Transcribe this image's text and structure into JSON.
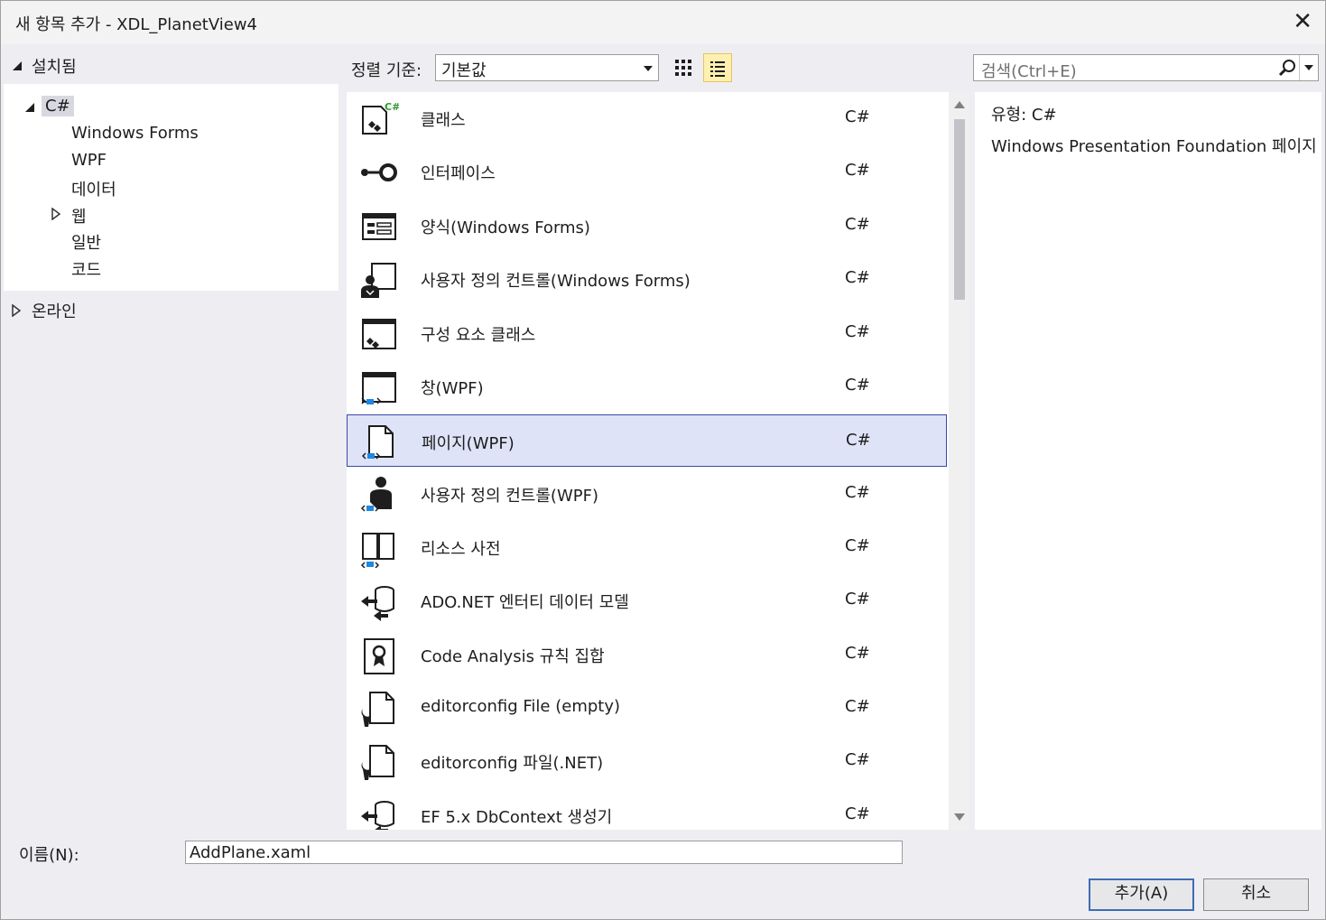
{
  "window": {
    "title": "새 항목 추가 - XDL_PlanetView4"
  },
  "tree": {
    "installed_label": "설치됨",
    "csharp_label": "C#",
    "children": [
      "Windows Forms",
      "WPF",
      "데이터",
      "웹",
      "일반",
      "코드"
    ],
    "online_label": "온라인"
  },
  "toolbar": {
    "sort_label": "정렬 기준:",
    "sort_value": "기본값",
    "search_placeholder": "검색(Ctrl+E)"
  },
  "templates": [
    {
      "name": "클래스",
      "lang": "C#",
      "icon": "class-icon"
    },
    {
      "name": "인터페이스",
      "lang": "C#",
      "icon": "interface-icon"
    },
    {
      "name": "양식(Windows Forms)",
      "lang": "C#",
      "icon": "form-icon"
    },
    {
      "name": "사용자 정의 컨트롤(Windows Forms)",
      "lang": "C#",
      "icon": "user-control-icon"
    },
    {
      "name": "구성 요소 클래스",
      "lang": "C#",
      "icon": "component-class-icon"
    },
    {
      "name": "창(WPF)",
      "lang": "C#",
      "icon": "window-icon"
    },
    {
      "name": "페이지(WPF)",
      "lang": "C#",
      "icon": "page-icon",
      "selected": true
    },
    {
      "name": "사용자 정의 컨트롤(WPF)",
      "lang": "C#",
      "icon": "wpf-user-control-icon"
    },
    {
      "name": "리소스 사전",
      "lang": "C#",
      "icon": "resource-dictionary-icon"
    },
    {
      "name": "ADO.NET 엔터티 데이터 모델",
      "lang": "C#",
      "icon": "entity-model-icon"
    },
    {
      "name": "Code Analysis 규칙 집합",
      "lang": "C#",
      "icon": "rule-set-icon"
    },
    {
      "name": "editorconfig File (empty)",
      "lang": "C#",
      "icon": "editorconfig-icon"
    },
    {
      "name": "editorconfig 파일(.NET)",
      "lang": "C#",
      "icon": "editorconfig-icon"
    },
    {
      "name": "EF 5.x DbContext 생성기",
      "lang": "C#",
      "icon": "dbcontext-generator-icon"
    }
  ],
  "details": {
    "type_label": "유형:",
    "type_value": "C#",
    "description": "Windows Presentation Foundation 페이지"
  },
  "footer": {
    "name_label": "이름(N):",
    "name_value": "AddPlane.xaml",
    "add_button": "추가(A)",
    "cancel_button": "취소"
  },
  "colors": {
    "selection_bg": "#dee3f8",
    "selection_border": "#3a4aa3",
    "accent_blue": "#1e88e5"
  }
}
